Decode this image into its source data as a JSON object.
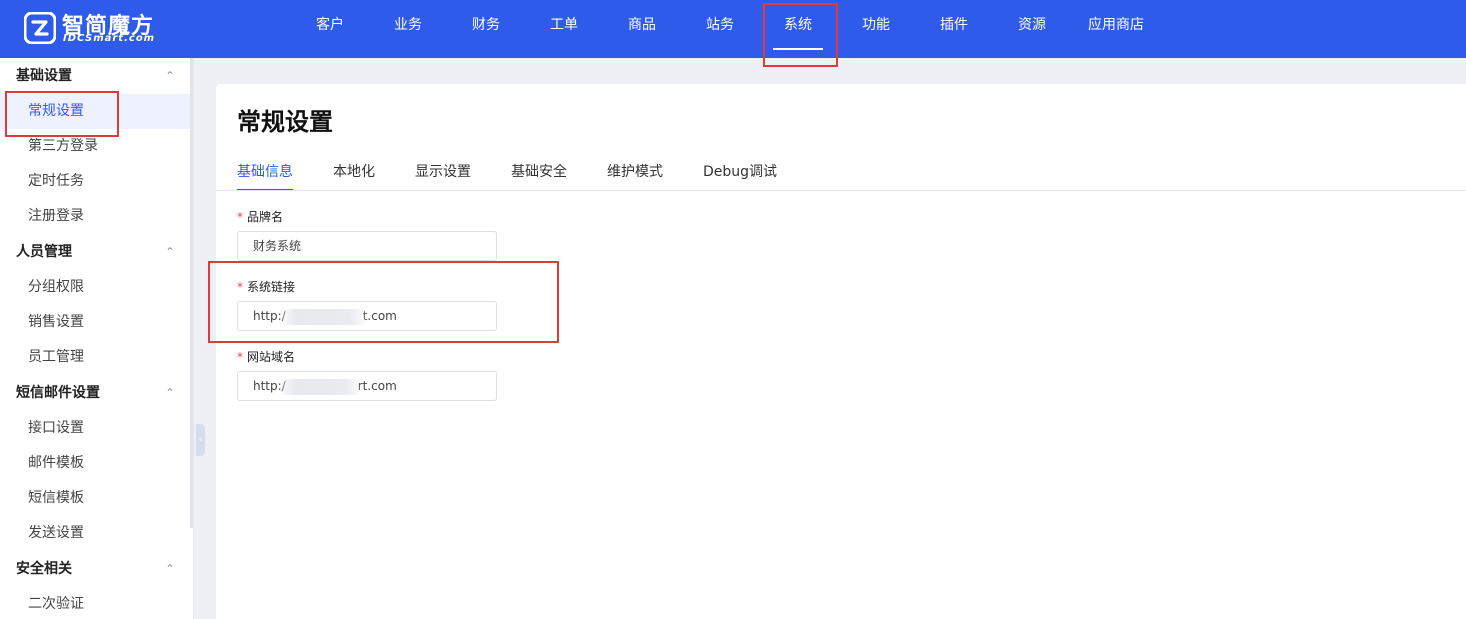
{
  "brand": {
    "name": "智简魔方",
    "sub": "IDCSmart.com"
  },
  "nav": [
    {
      "label": "客户"
    },
    {
      "label": "业务"
    },
    {
      "label": "财务"
    },
    {
      "label": "工单"
    },
    {
      "label": "商品"
    },
    {
      "label": "站务"
    },
    {
      "label": "系统",
      "active": true
    },
    {
      "label": "功能"
    },
    {
      "label": "插件"
    },
    {
      "label": "资源"
    },
    {
      "label": "应用商店"
    }
  ],
  "sidebar": {
    "groups": [
      {
        "label": "基础设置",
        "items": [
          "常规设置",
          "第三方登录",
          "定时任务",
          "注册登录"
        ]
      },
      {
        "label": "人员管理",
        "items": [
          "分组权限",
          "销售设置",
          "员工管理"
        ]
      },
      {
        "label": "短信邮件设置",
        "items": [
          "接口设置",
          "邮件模板",
          "短信模板",
          "发送设置"
        ]
      },
      {
        "label": "安全相关",
        "items": [
          "二次验证"
        ]
      }
    ],
    "active_item": "常规设置"
  },
  "page": {
    "title": "常规设置",
    "tabs": [
      "基础信息",
      "本地化",
      "显示设置",
      "基础安全",
      "维护模式",
      "Debug调试"
    ],
    "active_tab": "基础信息"
  },
  "form": {
    "required_mark": "*",
    "brand_name": {
      "label": "品牌名",
      "value": "财务系统"
    },
    "system_link": {
      "label": "系统链接",
      "value_prefix": "http:/",
      "value_suffix": "t.com"
    },
    "site_domain": {
      "label": "网站域名",
      "value_prefix": "http:/",
      "value_suffix": "rt.com"
    }
  },
  "colors": {
    "brand_blue": "#2e5bea",
    "highlight_red": "#e03a3a",
    "required_red": "#e5484d"
  }
}
